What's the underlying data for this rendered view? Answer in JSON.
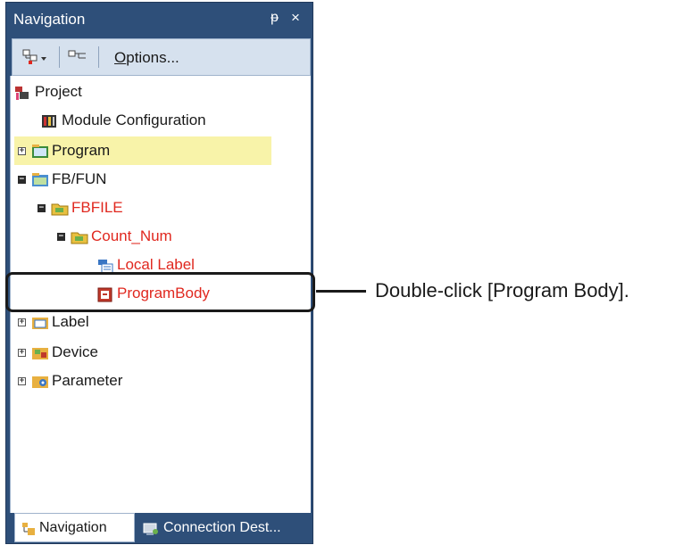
{
  "panel": {
    "title": "Navigation",
    "pin_glyph": "ᵽ",
    "close_glyph": "×",
    "pin_icon": "pin-icon",
    "close_icon": "close-icon"
  },
  "toolbar": {
    "options_label": "Options...",
    "options_mnemonic": "O",
    "options_rest": "ptions..."
  },
  "tree": [
    {
      "label": "Project",
      "icon": "project-icon"
    },
    {
      "label": "Module Configuration",
      "icon": "module-configuration-icon"
    },
    {
      "label": "Program",
      "icon": "program-icon",
      "expander": "+",
      "selected": true
    },
    {
      "label": "FB/FUN",
      "icon": "fb-fun-folder-icon",
      "expander": "-"
    },
    {
      "label": "FBFILE",
      "icon": "folder-icon",
      "expander": "-",
      "color": "#e0281f"
    },
    {
      "label": "Count_Num",
      "icon": "folder-icon",
      "expander": "-",
      "color": "#e0281f"
    },
    {
      "label": "Local Label",
      "icon": "local-label-icon",
      "color": "#e0281f"
    },
    {
      "label": "ProgramBody",
      "icon": "program-body-icon",
      "color": "#e0281f"
    },
    {
      "label": "Label",
      "icon": "label-icon",
      "expander": "+"
    },
    {
      "label": "Device",
      "icon": "device-icon",
      "expander": "+"
    },
    {
      "label": "Parameter",
      "icon": "parameter-icon",
      "expander": "+"
    }
  ],
  "tabs": [
    {
      "label": "Navigation",
      "icon": "navigation-tab-icon",
      "active": true
    },
    {
      "label": "Connection Dest...",
      "icon": "connection-destination-icon",
      "active": false
    }
  ],
  "callout": {
    "text": "Double-click [Program Body]."
  },
  "colors": {
    "panel_bg": "#2e4f79",
    "highlight": "#f8f3a9",
    "red_text": "#e0281f"
  }
}
